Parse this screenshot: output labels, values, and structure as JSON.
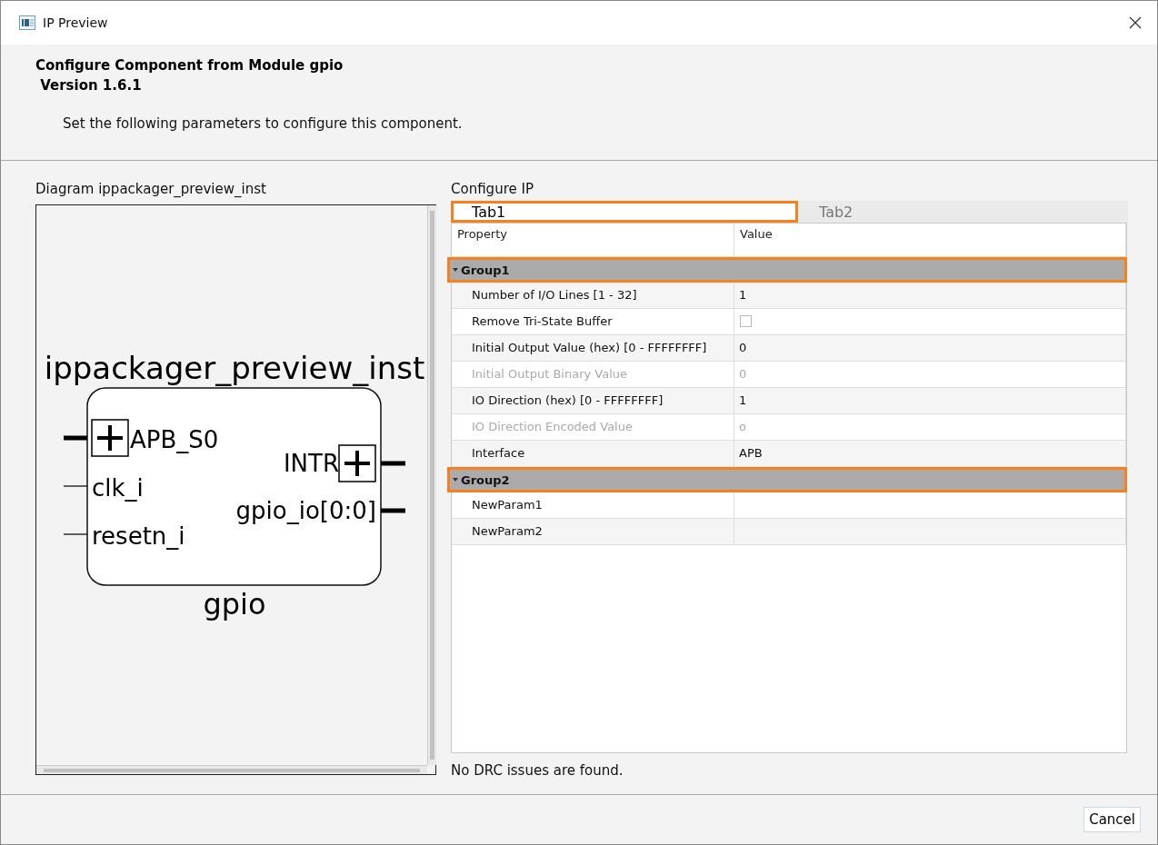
{
  "window": {
    "title": "IP Preview"
  },
  "header": {
    "title": "Configure Component from Module gpio",
    "version": " Version 1.6.1",
    "instruction": "Set the following parameters to configure this component."
  },
  "diagram": {
    "label": "Diagram ippackager_preview_inst",
    "instance": "ippackager_preview_inst",
    "module": "gpio",
    "left_ports": [
      {
        "name": "APB_S0",
        "kind": "bus"
      },
      {
        "name": "clk_i",
        "kind": "wire"
      },
      {
        "name": "resetn_i",
        "kind": "wire"
      }
    ],
    "right_ports": [
      {
        "name": "INTR",
        "kind": "bus"
      },
      {
        "name": "gpio_io[0:0]",
        "kind": "vector"
      }
    ]
  },
  "configure": {
    "label": "Configure IP",
    "tabs": [
      {
        "label": "Tab1",
        "selected": true,
        "highlighted": true
      },
      {
        "label": "Tab2",
        "selected": false,
        "highlighted": false
      }
    ],
    "columns": [
      "Property",
      "Value"
    ],
    "groups": [
      {
        "label": "Group1",
        "expanded": true,
        "highlighted": true,
        "rows": [
          {
            "property": "Number of I/O Lines  [1 - 32]",
            "kind": "text",
            "value": "1",
            "disabled": false
          },
          {
            "property": "Remove Tri-State Buffer",
            "kind": "checkbox",
            "checked": false,
            "disabled": false
          },
          {
            "property": "Initial Output Value (hex) [0 - FFFFFFFF]",
            "kind": "text",
            "value": "0",
            "disabled": false
          },
          {
            "property": "Initial Output Binary Value",
            "kind": "text",
            "value": "0",
            "disabled": true
          },
          {
            "property": "IO Direction (hex) [0 - FFFFFFFF]",
            "kind": "text",
            "value": "1",
            "disabled": false
          },
          {
            "property": "IO Direction Encoded Value",
            "kind": "text",
            "value": "o",
            "disabled": true
          },
          {
            "property": "Interface",
            "kind": "text",
            "value": "APB",
            "disabled": false
          }
        ]
      },
      {
        "label": "Group2",
        "expanded": true,
        "highlighted": true,
        "rows": [
          {
            "property": "NewParam1",
            "kind": "text",
            "disabled": false
          },
          {
            "property": "NewParam2",
            "kind": "text",
            "disabled": false
          }
        ]
      }
    ],
    "status": "No DRC issues are found."
  },
  "buttons": [
    "Cancel"
  ]
}
